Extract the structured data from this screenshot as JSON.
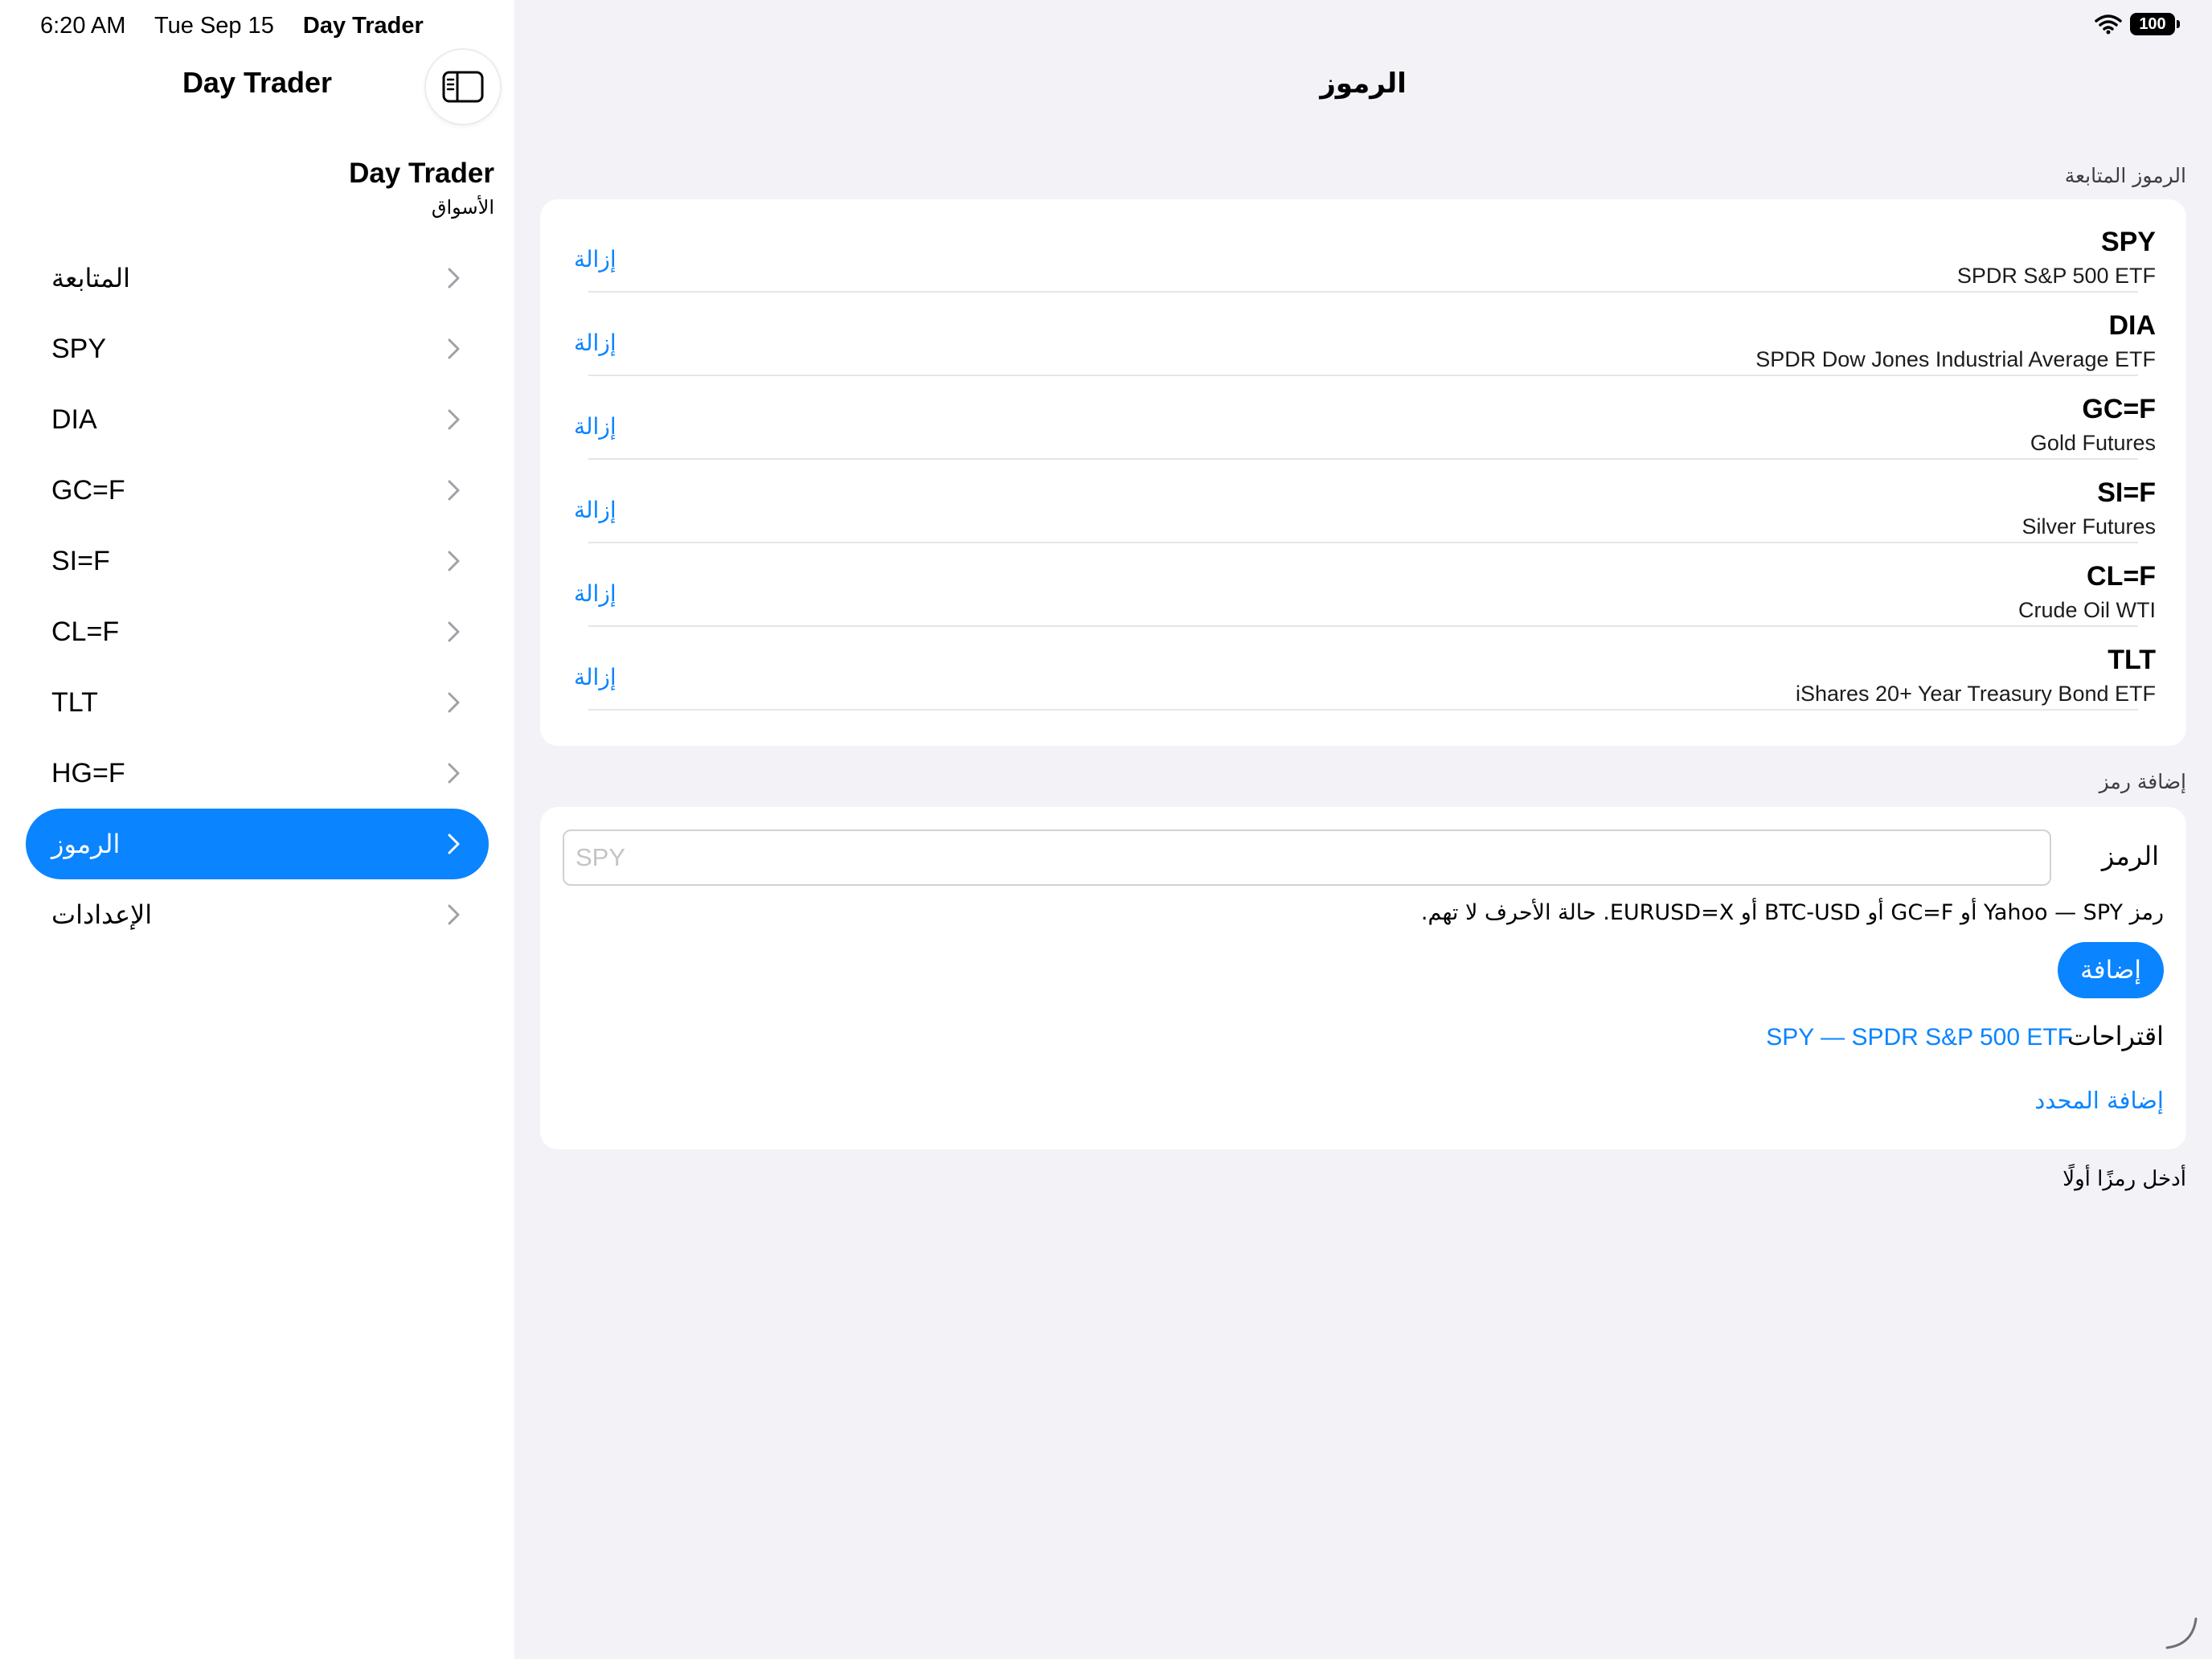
{
  "status": {
    "time": "6:20 AM",
    "date": "Tue Sep 15",
    "app": "Day Trader",
    "battery": "100"
  },
  "sidebar": {
    "title": "Day Trader",
    "toggle_icon": "sidebar-toggle-icon",
    "app_name": "Day Trader",
    "app_subtitle": "الأسواق",
    "items": [
      {
        "label": "المتابعة",
        "active": false
      },
      {
        "label": "SPY",
        "active": false
      },
      {
        "label": "DIA",
        "active": false
      },
      {
        "label": "GC=F",
        "active": false
      },
      {
        "label": "SI=F",
        "active": false
      },
      {
        "label": "CL=F",
        "active": false
      },
      {
        "label": "TLT",
        "active": false
      },
      {
        "label": "HG=F",
        "active": false
      },
      {
        "label": "الرموز",
        "active": true
      },
      {
        "label": "الإعدادات",
        "active": false
      }
    ]
  },
  "main": {
    "title": "الرموز",
    "tracked_header": "الرموز المتابعة",
    "remove_label": "إزالة",
    "tracked": [
      {
        "symbol": "SPY",
        "name": "SPDR S&P 500 ETF"
      },
      {
        "symbol": "DIA",
        "name": "SPDR Dow Jones Industrial Average ETF"
      },
      {
        "symbol": "GC=F",
        "name": "Gold Futures"
      },
      {
        "symbol": "SI=F",
        "name": "Silver Futures"
      },
      {
        "symbol": "CL=F",
        "name": "Crude Oil WTI"
      },
      {
        "symbol": "TLT",
        "name": "iShares 20+ Year Treasury Bond ETF"
      }
    ],
    "add_header": "إضافة رمز",
    "add": {
      "field_label": "الرمز",
      "placeholder": "SPY",
      "value": "",
      "hint": "رمز Yahoo — SPY أو GC=F أو BTC-USD أو EURUSD=X. حالة الأحرف لا تهم.",
      "add_button": "إضافة",
      "suggestions_label": "اقتراحات",
      "suggestion": "SPY — SPDR S&P 500 ETF",
      "add_selected": "إضافة المحدد"
    },
    "footer_note": "أدخل رمزًا أولًا"
  },
  "colors": {
    "accent": "#0a84ff",
    "background": "#f2f2f7",
    "card": "#ffffff"
  }
}
